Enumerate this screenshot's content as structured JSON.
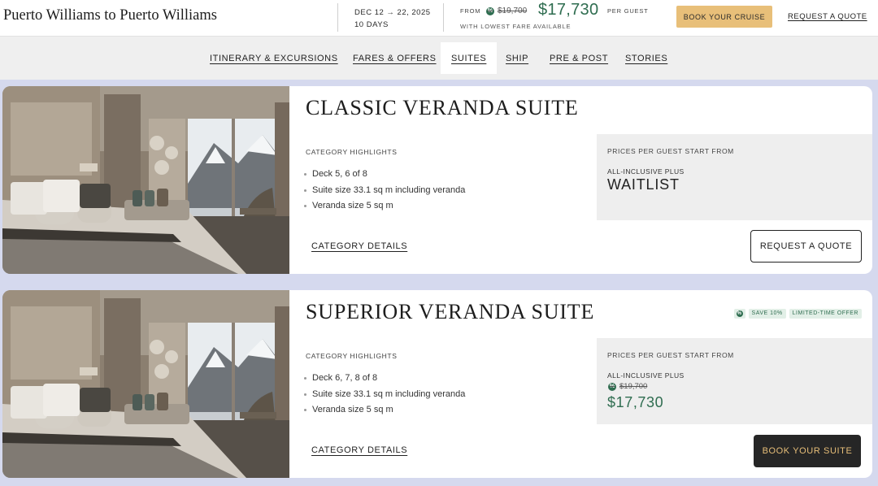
{
  "header": {
    "voyage_title": "Puerto Williams to Puerto Williams",
    "dates": "DEC 12 → 22, 2025",
    "duration": "10 DAYS",
    "from_label": "FROM",
    "original_price": "$19,700",
    "price": "$17,730",
    "per_guest": "PER GUEST",
    "lowest_fare_note": "WITH LOWEST FARE AVAILABLE",
    "book_cruise_label": "BOOK YOUR CRUISE",
    "request_quote_label": "REQUEST A QUOTE"
  },
  "nav": {
    "tabs": [
      {
        "label": "ITINERARY & EXCURSIONS"
      },
      {
        "label": "FARES & OFFERS"
      },
      {
        "label": "SUITES",
        "active": true
      },
      {
        "label": "SHIP"
      },
      {
        "label": "PRE & POST"
      },
      {
        "label": "STORIES"
      }
    ]
  },
  "suites": [
    {
      "name": "CLASSIC VERANDA SUITE",
      "highlights_label": "CATEGORY HIGHLIGHTS",
      "highlights": [
        "Deck 5, 6 of 8",
        "Suite size 33.1 sq m including veranda",
        "Veranda size 5 sq m"
      ],
      "category_details_label": "CATEGORY DETAILS",
      "prices_label": "PRICES PER GUEST START FROM",
      "fare_tier": "ALL-INCLUSIVE PLUS",
      "status": "WAITLIST",
      "action_label": "REQUEST A QUOTE"
    },
    {
      "name": "SUPERIOR VERANDA SUITE",
      "highlights_label": "CATEGORY HIGHLIGHTS",
      "highlights": [
        "Deck 6, 7, 8 of 8",
        "Suite size 33.1 sq m including veranda",
        "Veranda size 5 sq m"
      ],
      "category_details_label": "CATEGORY DETAILS",
      "prices_label": "PRICES PER GUEST START FROM",
      "fare_tier": "ALL-INCLUSIVE PLUS",
      "original_price": "$19,700",
      "price": "$17,730",
      "tags": [
        "SAVE 10%",
        "LIMITED-TIME OFFER"
      ],
      "action_label": "BOOK YOUR SUITE"
    }
  ],
  "icons": {
    "discount": "discount-badge-icon"
  },
  "colors": {
    "accent_gold": "#e8bf79",
    "price_green": "#2f6d50",
    "page_background": "#d5d9ee",
    "dark_button": "#262626"
  }
}
